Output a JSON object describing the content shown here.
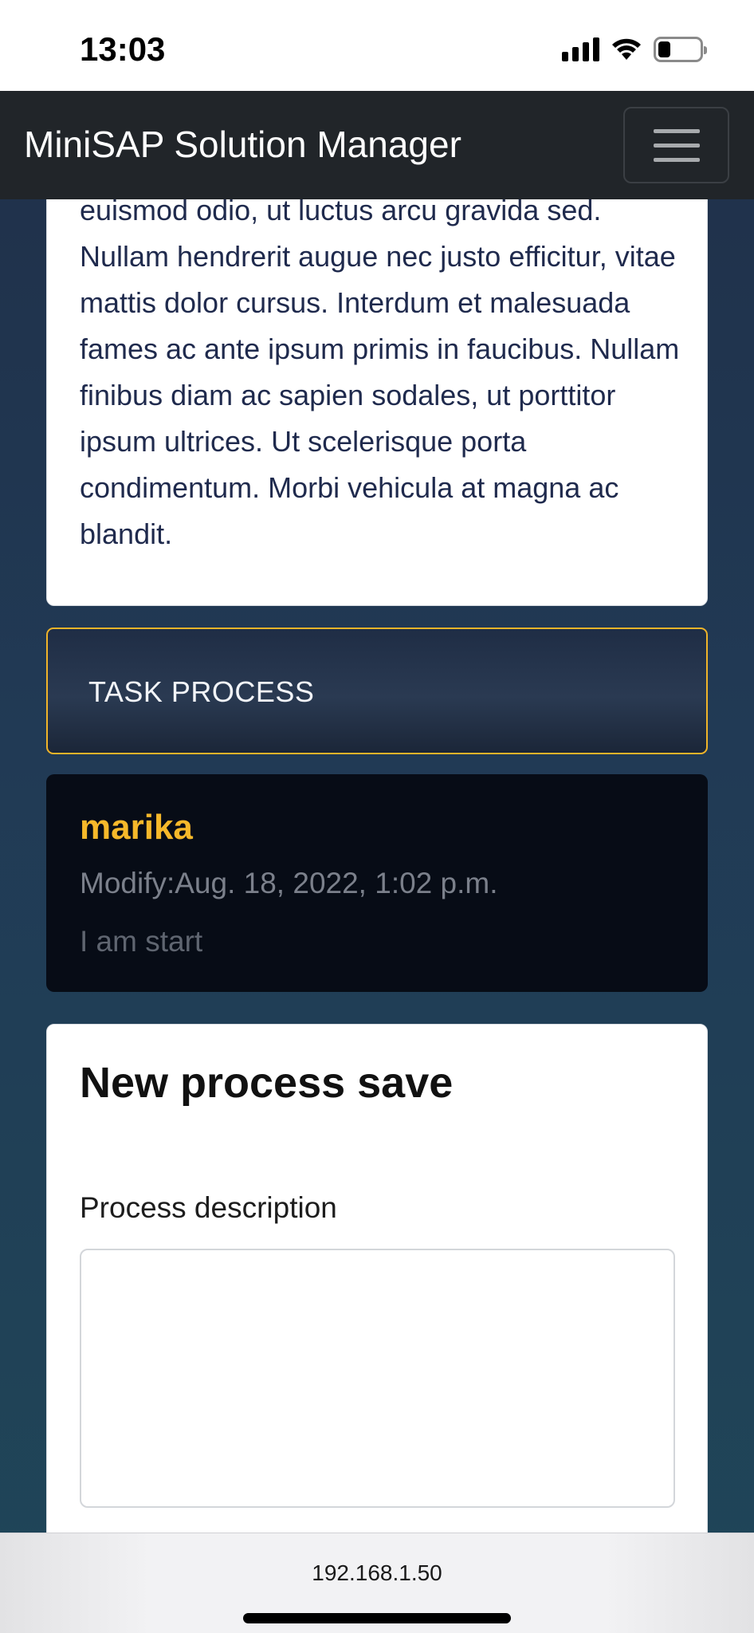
{
  "status_bar": {
    "time": "13:03",
    "icons": [
      "signal-icon",
      "wifi-icon",
      "battery-icon"
    ],
    "battery_level": 0.3
  },
  "navbar": {
    "brand": "MiniSAP Solution Manager",
    "menu_icon": "hamburger-menu-icon"
  },
  "description_card": {
    "text": "euismod odio, ut luctus arcu gravida sed. Nullam hendrerit augue nec justo efficitur, vitae mattis dolor cursus. Interdum et malesuada fames ac ante ipsum primis in faucibus. Nullam finibus diam ac sapien sodales, ut porttitor ipsum ultrices. Ut scelerisque porta condimentum. Morbi vehicula at magna ac blandit."
  },
  "task_process": {
    "label": "TASK PROCESS"
  },
  "process_entry": {
    "user": "marika",
    "modified": "Modify:Aug. 18, 2022, 1:02 p.m.",
    "description": "I am start"
  },
  "new_process_form": {
    "title": "New process save",
    "description_label": "Process description",
    "description_value": ""
  },
  "browser": {
    "url": "192.168.1.50"
  },
  "colors": {
    "accent": "#f6b82a",
    "navbar_bg": "#212529",
    "page_bg": "#213a55",
    "process_card_bg": "#070c16"
  }
}
